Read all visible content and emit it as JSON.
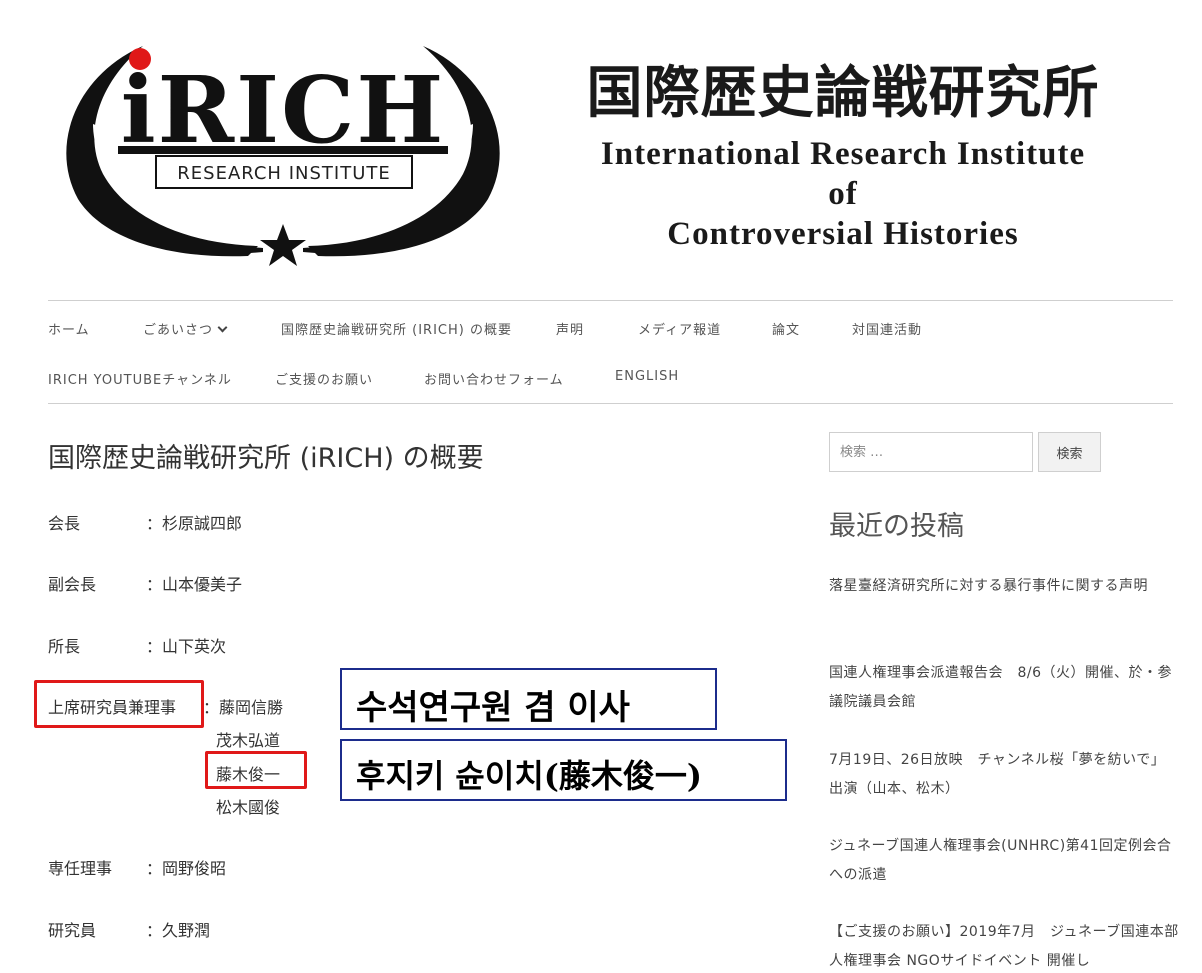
{
  "header": {
    "title_jp": "国際歴史論戦研究所",
    "title_en_line1": "International Research Institute",
    "title_en_line2": "of",
    "title_en_line3": "Controversial Histories",
    "logo_text": "iRICH",
    "logo_subtext": "RESEARCH INSTITUTE"
  },
  "nav": {
    "row1": [
      "ホーム",
      "ごあいさつ",
      "国際歴史論戦研究所 (IRICH) の概要",
      "声明",
      "メディア報道",
      "論文",
      "対国連活動"
    ],
    "row2": [
      "IRICH YOUTUBEチャンネル",
      "ご支援のお願い",
      "お問い合わせフォーム",
      "ENGLISH"
    ]
  },
  "main": {
    "page_title": "国際歴史論戦研究所 (iRICH) の概要",
    "staff": [
      {
        "role": "会長",
        "name": "：杉原誠四郎"
      },
      {
        "role": "副会長",
        "name": "：山本優美子"
      },
      {
        "role": "所長",
        "name": "：山下英次"
      },
      {
        "role": "上席研究員兼理事",
        "name": "：藤岡信勝"
      },
      {
        "role": "専任理事",
        "name": "：岡野俊昭"
      },
      {
        "role": "研究員",
        "name": "：久野潤"
      }
    ],
    "senior_members_extra": [
      "茂木弘道",
      "藤木俊一",
      "松木國俊"
    ],
    "annotation_1": "수석연구원 겸 이사",
    "annotation_2": "후지키 슌이치(藤木俊一)"
  },
  "sidebar": {
    "search_placeholder": "検索 …",
    "search_button": "検索",
    "recent_heading": "最近の投稿",
    "posts": [
      "落星臺経済研究所に対する暴行事件に関する声明",
      "国連人権理事会派遣報告会　8/6（火）開催、於・参議院議員会館",
      "7月19日、26日放映　チャンネル桜「夢を紡いで」出演（山本、松木）",
      "ジュネーブ国連人権理事会(UNHRC)第41回定例会合への派遣",
      "【ご支援のお願い】2019年7月　ジュネーブ国連本部 人権理事会 NGOサイドイベント 開催し"
    ]
  },
  "colors": {
    "highlight_red": "#e01818",
    "annotation_border": "#1c2c8c",
    "logo_dot": "#e01818"
  }
}
